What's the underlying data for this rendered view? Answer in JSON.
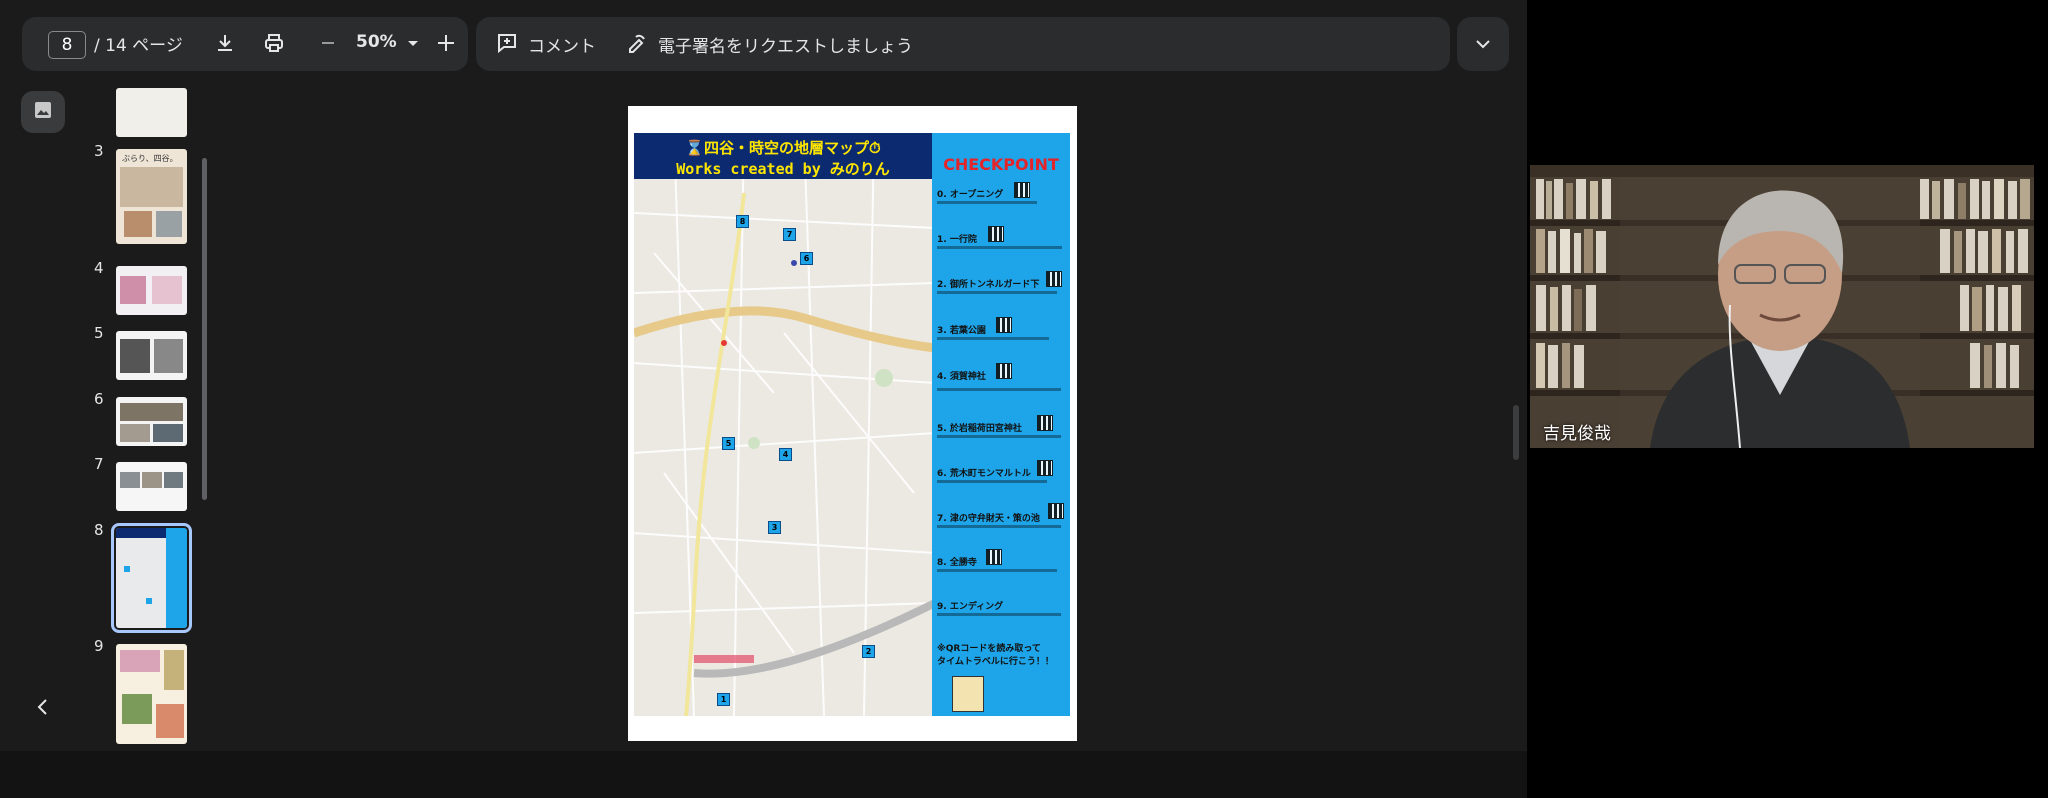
{
  "toolbar": {
    "current_page": "8",
    "page_total": "/ 14 ページ",
    "zoom": "50%",
    "comment_label": "コメント",
    "esign_label": "電子署名をリクエストしましょう"
  },
  "thumbnails": [
    {
      "number": "3",
      "active": false
    },
    {
      "number": "4",
      "active": false
    },
    {
      "number": "5",
      "active": false
    },
    {
      "number": "6",
      "active": false
    },
    {
      "number": "7",
      "active": false
    },
    {
      "number": "8",
      "active": true
    },
    {
      "number": "9",
      "active": false
    }
  ],
  "thumb3_caption": "ぶらり、四谷。",
  "document": {
    "title_line1": "⌛四谷・時空の地層マップ⏱",
    "title_line2": "Works created by みのりん",
    "checkpoint_title": "CHECKPOINT",
    "checkpoints": [
      "0. オープニング",
      "1. 一行院",
      "2. 御所トンネルガード下",
      "3. 若葉公園",
      "4. 須賀神社",
      "5. 於岩稲荷田宮神社",
      "6. 荒木町モンマルトル",
      "7. 津の守弁財天・策の池",
      "8. 全勝寺",
      "9. エンディング"
    ],
    "note_line1": "※QRコードを読み取って",
    "note_line2": "タイムトラベルに行こう！！",
    "map_markers": [
      "8",
      "7",
      "6",
      "5",
      "4",
      "3",
      "2",
      "1"
    ]
  },
  "participant": {
    "name": "吉見俊哉"
  },
  "colors": {
    "viewer_bg": "#1b1b1c",
    "toolbar_bg": "#2b2c2e",
    "title_band": "#0b2a70",
    "title_text": "#ffe600",
    "checkpoint_panel": "#1ea4e8",
    "checkpoint_title": "#e5242a",
    "active_thumb_outline": "#a8c7fa"
  }
}
